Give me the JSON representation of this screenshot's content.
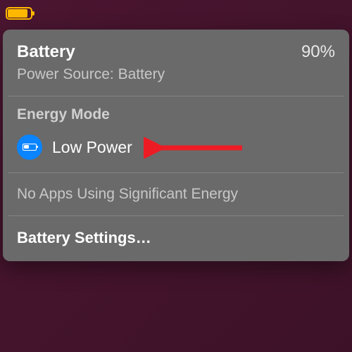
{
  "menubar": {
    "battery_icon": "battery-low-power-icon",
    "fill_color": "#ffb800"
  },
  "panel": {
    "title": "Battery",
    "percent": "90%",
    "power_source": "Power Source: Battery",
    "energy_mode": {
      "heading": "Energy Mode",
      "selected_icon": "battery-half-icon",
      "selected_label": "Low Power"
    },
    "significant_energy": "No Apps Using Significant Energy",
    "settings_label": "Battery Settings…"
  },
  "annotation": {
    "arrow_color": "#ed1c24",
    "target": "low-power-mode"
  }
}
